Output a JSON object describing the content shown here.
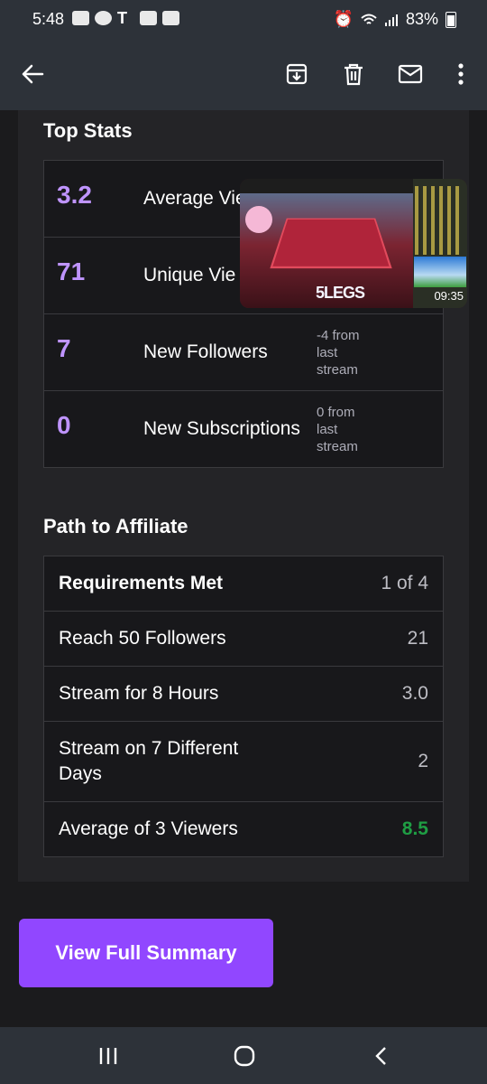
{
  "status_bar": {
    "time": "5:48",
    "battery": "83%"
  },
  "top_stats": {
    "title": "Top Stats",
    "rows": [
      {
        "value": "3.2",
        "label": "Average Viewers",
        "change": ""
      },
      {
        "value": "71",
        "label": "Unique Vie",
        "change": ""
      },
      {
        "value": "7",
        "label": "New Followers",
        "change": "-4 from last stream"
      },
      {
        "value": "0",
        "label": "New Subscriptions",
        "change": "0 from last stream"
      }
    ]
  },
  "affiliate": {
    "title": "Path to Affiliate",
    "rows": [
      {
        "label": "Requirements Met",
        "value": "1 of 4"
      },
      {
        "label": "Reach 50 Followers",
        "value": "21"
      },
      {
        "label": "Stream for 8 Hours",
        "value": "3.0"
      },
      {
        "label": "Stream on 7 Different Days",
        "value": "2"
      },
      {
        "label": "Average of 3 Viewers",
        "value": "8.5"
      }
    ]
  },
  "summary_button": {
    "label": "View Full Summary"
  },
  "pip": {
    "logo_text": "5LEGS",
    "duration": "09:35"
  },
  "colors": {
    "accent": "#9147ff",
    "stat_number": "#bf94ff",
    "met_green": "#1f9e44"
  }
}
